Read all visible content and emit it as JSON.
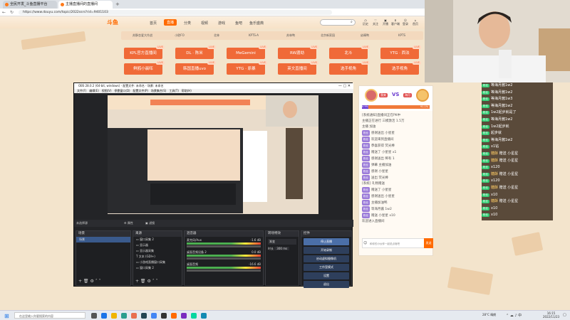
{
  "browser": {
    "tabs": [
      {
        "label": "全民开发_斗鱼直播平台"
      },
      {
        "label": "主播直播间的直播间"
      }
    ],
    "url": "https://www.douyu.com/topic/2022ssrs?rid=9401103"
  },
  "site": {
    "logo": "斗鱼",
    "nav": [
      "首页",
      "直播",
      "分类",
      "视频",
      "游戏",
      "鱼吧",
      "鱼乐盛典"
    ],
    "nav_active_index": 1,
    "search_placeholder": "",
    "top_icons": [
      "历史",
      "关注",
      "开播",
      "客户端",
      "登录",
      "首页",
      "本地作坊"
    ]
  },
  "rooms": {
    "top_cards": [
      "苏酥恋爱大作战",
      "小欧FO",
      "北林",
      "KPTS-A",
      "苏林鸭",
      "北京新家园",
      "幼晴鸭",
      "KPTS"
    ],
    "buttons": [
      {
        "label": "KPL官方直播间",
        "live": "LIVE"
      },
      {
        "label": "DL · 陈米",
        "live": "LIVE"
      },
      {
        "label": "MeGemini",
        "live": "LIVE"
      },
      {
        "label": "RW渡劫",
        "live": "LIVE"
      },
      {
        "label": "北斗",
        "live": "LIVE"
      },
      {
        "label": "YTG · 西法",
        "live": "LIVE"
      },
      {
        "label": "鲜鸥小晨晖",
        "live": "LIVE"
      },
      {
        "label": "韩国直播uvo",
        "live": "LIVE"
      },
      {
        "label": "YTG · 原暴",
        "live": "LIVE"
      },
      {
        "label": "英文直播间",
        "live": "LIVE"
      },
      {
        "label": "选手视角",
        "live": "LIVE"
      },
      {
        "label": "选手视角",
        "live": "LIVE"
      }
    ]
  },
  "danmaku": [
    {
      "user": "",
      "text": "等海月酱1w2"
    },
    {
      "user": "",
      "text": "等海月酱1w2"
    },
    {
      "user": "",
      "text": "等海月酱1w3"
    },
    {
      "user": "",
      "text": "等海月酱1w2"
    },
    {
      "user": "",
      "text": "1w2起步就是了"
    },
    {
      "user": "",
      "text": "等海月酱1w2"
    },
    {
      "user": "",
      "text": "1w2起步就"
    },
    {
      "user": "",
      "text": "起步就"
    },
    {
      "user": "",
      "text": "等海月酱1w2"
    },
    {
      "user": "",
      "text": "x1钻"
    },
    {
      "user": "糖酥",
      "text": "赠送 小星星"
    },
    {
      "user": "糖酥",
      "text": "赠送 小星星"
    },
    {
      "user": "",
      "text": "x120"
    },
    {
      "user": "糖酥",
      "text": "赠送 小星星"
    },
    {
      "user": "",
      "text": "x120"
    },
    {
      "user": "糖酥",
      "text": "赠送 小星星"
    },
    {
      "user": "",
      "text": "x10"
    },
    {
      "user": "糖酥",
      "text": "赠送 小星星"
    },
    {
      "user": "",
      "text": "x10"
    },
    {
      "user": "",
      "text": "x10"
    }
  ],
  "chat": {
    "pk_left": "我来",
    "pk_vs": "VS",
    "pk_right": "海月",
    "pk_left_pct": "8.9%",
    "pk_right_pct": "91.1%",
    "lines": [
      "[系统通知]直播间正在PK中",
      "主播正在进行 三模激活 1.5万",
      "主播 加油 ",
      "感谢送出 小星星",
      "欢迎来到直播间",
      "恭喜获得 荧光棒",
      "赠送了 小星星 x1",
      "感谢送出 稀有 1",
      "弹幕 主播加油",
      "感谢 小星星",
      "送出 荧光棒",
      "[系统] 礼物赠送",
      "赠送了 小星星",
      "感谢送出 小星星",
      "主播加油鸭",
      "等海月酱 1w2",
      "赠送 小星星 x10",
      "欢迎进入直播间"
    ],
    "input_placeholder": "和你的小伙伴一起说点啥吧",
    "send_label": "发送"
  },
  "obs": {
    "title": "OBS 28.0.2 (64-bit, windows) - 配置文件: 未命名 - 场景: 未命名",
    "menu": [
      "文件(F)",
      "编辑(E)",
      "视图(V)",
      "停靠窗口(D)",
      "配置文件(P)",
      "场景集合(S)",
      "工具(T)",
      "帮助(H)"
    ],
    "scene_bar": "未选择源",
    "props_label": "属性",
    "filter_label": "滤镜",
    "docks": {
      "scenes": {
        "title": "场景",
        "items": [
          "场景"
        ]
      },
      "sources": {
        "title": "来源",
        "items": [
          "窗口采集 2",
          "显示器",
          "显示器采集",
          "文本 (GDI+)",
          "小游戏直播窗口采集",
          "窗口采集 2"
        ]
      },
      "mixer": {
        "title": "混音器",
        "channels": [
          {
            "name": "麦克风/Aux",
            "level": "-1.6 dB"
          },
          {
            "name": "桌面音频设备 2",
            "level": "0.0 dB"
          },
          {
            "name": "桌面音频",
            "level": "-16.6 dB"
          }
        ]
      },
      "transitions": {
        "title": "转场特效",
        "type": "渐变",
        "duration_label": "时长",
        "duration": "300 ms"
      },
      "controls": {
        "title": "控件",
        "buttons": [
          "停止直播",
          "开始录制",
          "启动虚拟摄像机",
          "工作室模式",
          "设置",
          "退出"
        ]
      }
    }
  },
  "taskbar": {
    "search": "在这里输入你要搜索的内容",
    "weather": "28°C 晴朗",
    "time": "16:15",
    "date": "2022/11/23"
  },
  "colors": {
    "accent": "#ff6a00",
    "button": "#f06a38",
    "obs_bg": "#232427",
    "obs_control": "#2e3f5c"
  }
}
